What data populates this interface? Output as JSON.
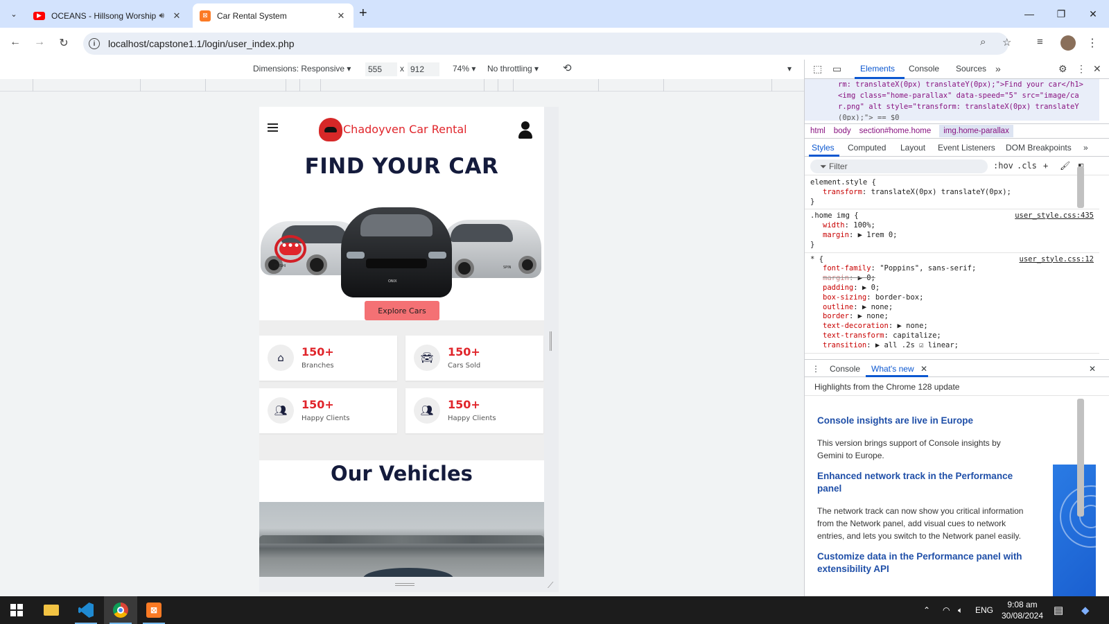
{
  "browser": {
    "tabs": [
      {
        "title": "OCEANS - Hillsong Worship",
        "favicon": "youtube-icon"
      },
      {
        "title": "Car Rental System",
        "favicon": "xampp-icon"
      }
    ],
    "url": "localhost/capstone1.1/login/user_index.php"
  },
  "device_toolbar": {
    "dimensions_label": "Dimensions: Responsive",
    "width": "555",
    "times": "x",
    "height": "912",
    "zoom": "74%",
    "throttling": "No throttling"
  },
  "site": {
    "brand": "Chadoyven Car Rental",
    "hero_title": "FIND YOUR CAR",
    "explore_label": "Explore Cars",
    "chat_dots": "•••",
    "stats": [
      {
        "value": "150+",
        "label": "Branches",
        "icon": "home-icon"
      },
      {
        "value": "150+",
        "label": "Cars Sold",
        "icon": "car-icon"
      },
      {
        "value": "150+",
        "label": "Happy Clients",
        "icon": "users-icon"
      },
      {
        "value": "150+",
        "label": "Happy Clients",
        "icon": "users-icon"
      }
    ],
    "vehicles_title_a": "Our ",
    "vehicles_title_b": "Vehicles",
    "car_plates": [
      "FRISHI",
      "ONIX",
      "SPIN"
    ]
  },
  "devtools": {
    "tabs": [
      "Elements",
      "Console",
      "Sources"
    ],
    "dom_lines": [
      "rm: translateX(0px) translateY(0px);\">Find your car</h1>",
      "<img class=\"home-parallax\" data-speed=\"5\" src=\"image/ca",
      "r.png\" alt style=\"transform: translateX(0px) translateY",
      "(0px);\"> == $0"
    ],
    "breadcrumbs": [
      "html",
      "body",
      "section#home.home",
      "img.home-parallax"
    ],
    "style_tabs": [
      "Styles",
      "Computed",
      "Layout",
      "Event Listeners",
      "DOM Breakpoints"
    ],
    "filter_placeholder": "Filter",
    "filter_options": [
      ":hov",
      ".cls"
    ],
    "rules": [
      {
        "selector": "element.style {",
        "source": "",
        "decls": [
          {
            "prop": "transform",
            "value": "translateX(0px) translateY(0px);",
            "struck": false
          }
        ]
      },
      {
        "selector": ".home img {",
        "source": "user_style.css:435",
        "decls": [
          {
            "prop": "width",
            "value": "100%;",
            "struck": false
          },
          {
            "prop": "margin",
            "value": "▶ 1rem 0;",
            "struck": false
          }
        ]
      },
      {
        "selector": "* {",
        "source": "user_style.css:12",
        "decls": [
          {
            "prop": "font-family",
            "value": "\"Poppins\", sans-serif;",
            "struck": false
          },
          {
            "prop": "margin",
            "value": "▶ 0;",
            "struck": true
          },
          {
            "prop": "padding",
            "value": "▶ 0;",
            "struck": false
          },
          {
            "prop": "box-sizing",
            "value": "border-box;",
            "struck": false
          },
          {
            "prop": "outline",
            "value": "▶ none;",
            "struck": false
          },
          {
            "prop": "border",
            "value": "▶ none;",
            "struck": false
          },
          {
            "prop": "text-decoration",
            "value": "▶ none;",
            "struck": false
          },
          {
            "prop": "text-transform",
            "value": "capitalize;",
            "struck": false
          },
          {
            "prop": "transition",
            "value": "▶ all .2s ☑ linear;",
            "struck": false
          }
        ]
      }
    ],
    "close_brace": "}",
    "drawer_tabs": [
      "Console",
      "What's new"
    ],
    "drawer_subtitle": "Highlights from the Chrome 128 update",
    "whats_new": [
      {
        "heading": "Console insights are live in Europe",
        "body": "This version brings support of Console insights by Gemini to Europe."
      },
      {
        "heading": "Enhanced network track in the Performance panel",
        "body": "The network track can now show you critical information from the Network panel, add visual cues to network entries, and lets you switch to the Network panel easily."
      },
      {
        "heading": "Customize data in the Performance panel with extensibility API",
        "body": ""
      }
    ]
  },
  "taskbar": {
    "language": "ENG",
    "time": "9:08 am",
    "date": "30/08/2024"
  },
  "colors": {
    "brand_red": "#e0252b",
    "navy": "#141b3c",
    "explore_button": "#f47174",
    "devtools_accent": "#0b57d0"
  }
}
